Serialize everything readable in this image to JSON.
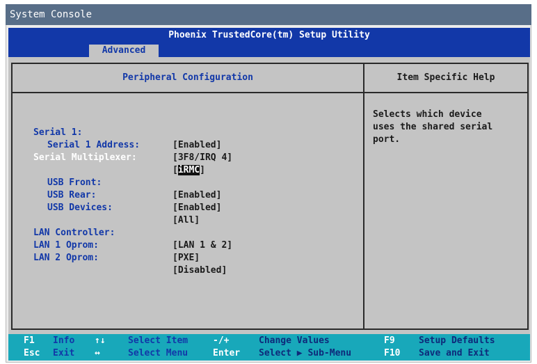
{
  "window": {
    "title": "System Console"
  },
  "header": {
    "title": "Phoenix TrustedCore(tm) Setup Utility"
  },
  "menu": {
    "tabs": [
      {
        "label": "Advanced",
        "active": true
      }
    ]
  },
  "main_panel": {
    "title": "Peripheral Configuration",
    "items": [
      {
        "label": "Serial 1:",
        "value": "[Enabled]",
        "indent": 0
      },
      {
        "label": "Serial 1 Address:",
        "value": "[3F8/IRQ 4]",
        "indent": 1
      },
      {
        "label": "Serial Multiplexer:",
        "value_open": "[",
        "value_selected": "iRMC",
        "value_close": "]",
        "selected": true
      },
      {
        "label": "USB Front:",
        "value": "[Enabled]",
        "indent": 1
      },
      {
        "label": "USB Rear:",
        "value": "[Enabled]",
        "indent": 1
      },
      {
        "label": "USB Devices:",
        "value": "[All]",
        "indent": 1
      },
      {
        "label": "LAN Controller:",
        "value": "[LAN 1 & 2]",
        "indent": 0
      },
      {
        "label": "LAN 1 Oprom:",
        "value": "[PXE]",
        "indent": 0
      },
      {
        "label": "LAN 2 Oprom:",
        "value": "[Disabled]",
        "indent": 0
      }
    ]
  },
  "help_panel": {
    "title": "Item Specific Help",
    "text": "Selects which device\nuses the shared serial\nport."
  },
  "footer": {
    "row1": [
      {
        "key": "F1",
        "desc": "Info"
      },
      {
        "key": "↑↓",
        "desc": "Select Item"
      },
      {
        "key": "-/+",
        "desc": "Change Values"
      },
      {
        "key": "F9",
        "desc": "Setup Defaults"
      }
    ],
    "row2": [
      {
        "key": "Esc",
        "desc": "Exit"
      },
      {
        "key": "↔",
        "desc": "Select Menu"
      },
      {
        "key": "Enter",
        "desc": "Select ▶ Sub-Menu"
      },
      {
        "key": "F10",
        "desc": "Save and Exit"
      }
    ]
  },
  "colors": {
    "header_blue": "#1238a8",
    "screen_gray": "#c4c4c4",
    "footer_cyan": "#18a8ba",
    "window_title": "#586e88"
  }
}
